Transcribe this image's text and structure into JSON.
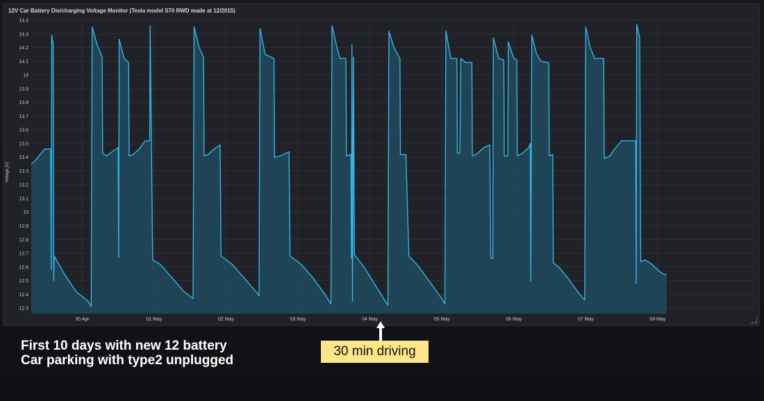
{
  "panel": {
    "title": "12V Car Battery Dis/charging Voltage Monitor (Tesla model S70 RWD made at 12/2015)"
  },
  "caption": {
    "line1": "First 10 days with new 12 battery",
    "line2": "Car parking with type2 unplugged"
  },
  "callout": {
    "text": "30 min driving"
  },
  "colors": {
    "line": "#33b5e5",
    "fill": "#1f4a5f",
    "grid": "#303139",
    "callout_bg": "#fde68a",
    "text": "#c7c8ca"
  },
  "icons": {
    "arrow": "arrow-up-icon",
    "resize": "resize-handle-icon"
  },
  "chart_data": {
    "type": "area",
    "title": "12V Car Battery Dis/charging Voltage Monitor (Tesla model S70 RWD made at 12/2015)",
    "xlabel": "",
    "ylabel": "Voltage [V]",
    "ylim": [
      12.26,
      14.4
    ],
    "yticks": [
      12.3,
      12.4,
      12.5,
      12.6,
      12.7,
      12.8,
      12.9,
      13,
      13.1,
      13.2,
      13.3,
      13.4,
      13.5,
      13.6,
      13.7,
      13.8,
      13.9,
      14,
      14.1,
      14.2,
      14.3,
      14.4
    ],
    "xlim": [
      "2026-04-29T07:00",
      "2026-05-09T08:00"
    ],
    "xticks": [
      {
        "t": "2026-04-30T00:00",
        "label": "30 Apr"
      },
      {
        "t": "2026-05-01T00:00",
        "label": "01 May"
      },
      {
        "t": "2026-05-02T00:00",
        "label": "02 May"
      },
      {
        "t": "2026-05-03T00:00",
        "label": "03 May"
      },
      {
        "t": "2026-05-04T00:00",
        "label": "04 May"
      },
      {
        "t": "2026-05-05T00:00",
        "label": "05 May"
      },
      {
        "t": "2026-05-06T00:00",
        "label": "06 May"
      },
      {
        "t": "2026-05-07T00:00",
        "label": "07 May"
      },
      {
        "t": "2026-05-08T00:00",
        "label": "08 May"
      }
    ],
    "grid": true,
    "legend": "none",
    "series": [
      {
        "name": "Voltage",
        "points": [
          [
            "2026-04-29T07:00",
            13.35
          ],
          [
            "2026-04-29T08:30",
            13.38
          ],
          [
            "2026-04-29T10:00",
            13.42
          ],
          [
            "2026-04-29T11:30",
            13.46
          ],
          [
            "2026-04-29T13:00",
            13.46
          ],
          [
            "2026-04-29T13:30",
            13.46
          ],
          [
            "2026-04-29T13:40",
            12.58
          ],
          [
            "2026-04-29T13:50",
            14.29
          ],
          [
            "2026-04-29T14:20",
            14.22
          ],
          [
            "2026-04-29T14:30",
            12.5
          ],
          [
            "2026-04-29T14:40",
            12.68
          ],
          [
            "2026-04-29T18:00",
            12.55
          ],
          [
            "2026-04-29T22:00",
            12.42
          ],
          [
            "2026-04-30T02:00",
            12.35
          ],
          [
            "2026-04-30T03:00",
            12.31
          ],
          [
            "2026-04-30T03:20",
            14.35
          ],
          [
            "2026-04-30T05:00",
            14.22
          ],
          [
            "2026-04-30T06:40",
            14.13
          ],
          [
            "2026-04-30T06:50",
            13.43
          ],
          [
            "2026-04-30T08:00",
            13.41
          ],
          [
            "2026-04-30T10:00",
            13.44
          ],
          [
            "2026-04-30T12:00",
            13.47
          ],
          [
            "2026-04-30T12:10",
            12.67
          ],
          [
            "2026-04-30T12:20",
            14.26
          ],
          [
            "2026-04-30T14:00",
            14.12
          ],
          [
            "2026-04-30T15:30",
            14.09
          ],
          [
            "2026-04-30T15:40",
            13.41
          ],
          [
            "2026-04-30T17:00",
            13.42
          ],
          [
            "2026-04-30T19:00",
            13.46
          ],
          [
            "2026-04-30T21:00",
            13.52
          ],
          [
            "2026-04-30T22:30",
            13.52
          ],
          [
            "2026-04-30T22:40",
            14.36
          ],
          [
            "2026-04-30T23:30",
            12.65
          ],
          [
            "2026-05-01T02:00",
            12.62
          ],
          [
            "2026-05-01T06:00",
            12.52
          ],
          [
            "2026-05-01T10:00",
            12.42
          ],
          [
            "2026-05-01T13:00",
            12.37
          ],
          [
            "2026-05-01T13:20",
            14.35
          ],
          [
            "2026-05-01T15:00",
            14.2
          ],
          [
            "2026-05-01T16:30",
            14.13
          ],
          [
            "2026-05-01T16:40",
            13.41
          ],
          [
            "2026-05-01T18:00",
            13.42
          ],
          [
            "2026-05-01T20:00",
            13.46
          ],
          [
            "2026-05-01T22:00",
            13.49
          ],
          [
            "2026-05-01T22:20",
            12.68
          ],
          [
            "2026-05-02T02:00",
            12.62
          ],
          [
            "2026-05-02T06:00",
            12.52
          ],
          [
            "2026-05-02T10:00",
            12.42
          ],
          [
            "2026-05-02T11:00",
            12.39
          ],
          [
            "2026-05-02T11:20",
            14.34
          ],
          [
            "2026-05-02T13:00",
            14.15
          ],
          [
            "2026-05-02T16:00",
            14.12
          ],
          [
            "2026-05-02T16:10",
            13.4
          ],
          [
            "2026-05-02T18:00",
            13.41
          ],
          [
            "2026-05-02T20:00",
            13.43
          ],
          [
            "2026-05-02T21:00",
            13.44
          ],
          [
            "2026-05-02T21:20",
            12.68
          ],
          [
            "2026-05-03T01:00",
            12.62
          ],
          [
            "2026-05-03T05:00",
            12.52
          ],
          [
            "2026-05-03T09:00",
            12.4
          ],
          [
            "2026-05-03T11:00",
            12.33
          ],
          [
            "2026-05-03T11:20",
            14.36
          ],
          [
            "2026-05-03T13:00",
            14.2
          ],
          [
            "2026-05-03T14:00",
            14.12
          ],
          [
            "2026-05-03T16:00",
            14.12
          ],
          [
            "2026-05-03T16:10",
            13.41
          ],
          [
            "2026-05-03T17:40",
            13.42
          ],
          [
            "2026-05-03T17:50",
            12.66
          ],
          [
            "2026-05-03T18:00",
            14.22
          ],
          [
            "2026-05-03T18:10",
            12.35
          ],
          [
            "2026-05-03T18:30",
            14.13
          ],
          [
            "2026-05-03T18:50",
            12.69
          ],
          [
            "2026-05-03T22:00",
            12.6
          ],
          [
            "2026-05-04T02:00",
            12.46
          ],
          [
            "2026-05-04T06:00",
            12.32
          ],
          [
            "2026-05-04T06:20",
            14.32
          ],
          [
            "2026-05-04T08:00",
            14.2
          ],
          [
            "2026-05-04T10:00",
            14.12
          ],
          [
            "2026-05-04T10:10",
            13.42
          ],
          [
            "2026-05-04T12:00",
            13.42
          ],
          [
            "2026-05-04T13:00",
            12.68
          ],
          [
            "2026-05-04T16:00",
            12.61
          ],
          [
            "2026-05-04T20:00",
            12.49
          ],
          [
            "2026-05-05T00:00",
            12.37
          ],
          [
            "2026-05-05T01:00",
            12.33
          ],
          [
            "2026-05-05T01:20",
            14.32
          ],
          [
            "2026-05-05T03:00",
            14.12
          ],
          [
            "2026-05-05T05:00",
            14.12
          ],
          [
            "2026-05-05T05:10",
            13.43
          ],
          [
            "2026-05-05T06:00",
            13.43
          ],
          [
            "2026-05-05T06:20",
            14.12
          ],
          [
            "2026-05-05T08:00",
            14.09
          ],
          [
            "2026-05-05T10:00",
            14.09
          ],
          [
            "2026-05-05T10:10",
            13.41
          ],
          [
            "2026-05-05T12:00",
            13.43
          ],
          [
            "2026-05-05T14:00",
            13.47
          ],
          [
            "2026-05-05T16:00",
            13.49
          ],
          [
            "2026-05-05T16:20",
            12.67
          ],
          [
            "2026-05-05T17:00",
            12.66
          ],
          [
            "2026-05-05T17:10",
            14.27
          ],
          [
            "2026-05-05T19:00",
            14.12
          ],
          [
            "2026-05-05T20:40",
            14.11
          ],
          [
            "2026-05-05T20:50",
            13.41
          ],
          [
            "2026-05-05T22:00",
            13.41
          ],
          [
            "2026-05-05T22:10",
            14.24
          ],
          [
            "2026-05-06T00:00",
            14.12
          ],
          [
            "2026-05-06T01:00",
            14.11
          ],
          [
            "2026-05-06T01:10",
            13.41
          ],
          [
            "2026-05-06T03:00",
            13.43
          ],
          [
            "2026-05-06T05:00",
            13.47
          ],
          [
            "2026-05-06T05:30",
            13.5
          ],
          [
            "2026-05-06T05:40",
            12.5
          ],
          [
            "2026-05-06T06:00",
            14.29
          ],
          [
            "2026-05-06T07:30",
            14.16
          ],
          [
            "2026-05-06T09:00",
            14.1
          ],
          [
            "2026-05-06T11:40",
            14.09
          ],
          [
            "2026-05-06T11:50",
            13.41
          ],
          [
            "2026-05-06T13:00",
            13.42
          ],
          [
            "2026-05-06T13:10",
            12.63
          ],
          [
            "2026-05-06T15:00",
            12.6
          ],
          [
            "2026-05-06T18:00",
            12.52
          ],
          [
            "2026-05-06T22:00",
            12.4
          ],
          [
            "2026-05-06T23:40",
            12.36
          ],
          [
            "2026-05-07T00:00",
            14.35
          ],
          [
            "2026-05-07T01:30",
            14.2
          ],
          [
            "2026-05-07T03:00",
            14.12
          ],
          [
            "2026-05-07T06:00",
            14.12
          ],
          [
            "2026-05-07T06:10",
            13.39
          ],
          [
            "2026-05-07T08:00",
            13.41
          ],
          [
            "2026-05-07T10:00",
            13.47
          ],
          [
            "2026-05-07T12:00",
            13.52
          ],
          [
            "2026-05-07T16:40",
            13.52
          ],
          [
            "2026-05-07T16:50",
            12.48
          ],
          [
            "2026-05-07T17:00",
            14.37
          ],
          [
            "2026-05-07T18:00",
            14.27
          ],
          [
            "2026-05-07T18:20",
            12.64
          ],
          [
            "2026-05-07T20:00",
            12.65
          ],
          [
            "2026-05-07T22:00",
            12.62
          ],
          [
            "2026-05-08T01:00",
            12.56
          ],
          [
            "2026-05-08T03:00",
            12.54
          ]
        ]
      }
    ]
  }
}
